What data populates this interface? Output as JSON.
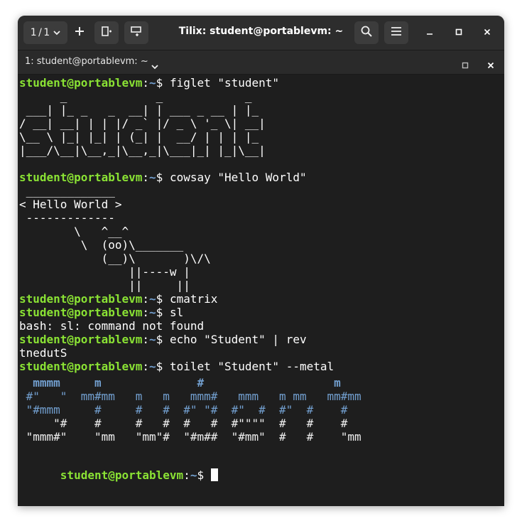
{
  "window": {
    "title": "Tilix: student@portablevm: ~",
    "session_counter": "1 / 1",
    "buttons": {
      "add": "+",
      "search": "⌕",
      "menu": "☰",
      "minimize": "–",
      "maximize": "□",
      "close": "✕"
    }
  },
  "tab": {
    "title": "1: student@portablevm: ~",
    "dropdown": "⌄",
    "maximize": "□",
    "close": "✕"
  },
  "terminal": {
    "prompt_user": "student@portablevm",
    "prompt_sep": ":",
    "prompt_path": "~",
    "prompt_symbol": "$ ",
    "lines": [
      {
        "type": "prompt",
        "cmd": "figlet \"student\""
      },
      {
        "type": "out",
        "text": "      _             _            _   \n ___| |_ _   _  __| | ___ _ __ | |_ \n/ __| __| | | |/ _` |/ _ \\ '_ \\| __|\n\\__ \\ |_| |_| | (_| |  __/ | | | |_ \n|___/\\__|\\__,_|\\__,_|\\___|_| |_|\\__|\n "
      },
      {
        "type": "prompt",
        "cmd": "cowsay \"Hello World\""
      },
      {
        "type": "out",
        "text": " _____________\n< Hello World >\n -------------\n        \\   ^__^\n         \\  (oo)\\_______\n            (__)\\       )\\/\\\n                ||----w |\n                ||     ||"
      },
      {
        "type": "prompt",
        "cmd": "cmatrix"
      },
      {
        "type": "prompt",
        "cmd": "sl"
      },
      {
        "type": "out",
        "text": "bash: sl: command not found"
      },
      {
        "type": "prompt",
        "cmd": "echo \"Student\" | rev"
      },
      {
        "type": "out",
        "text": "tnedutS"
      },
      {
        "type": "prompt",
        "cmd": "toilet \"Student\" --metal"
      }
    ],
    "toilet_art": [
      "  mmmm     m              #                   m   ",
      " #\"   \"  mm#mm   m   m   mmm#   mmm   m mm   mm#mm ",
      " \"#mmm     #     #   #  #\" \"#  #\"  #  #\"  #    #   ",
      "     \"#    #     #   #  #   #  #\"\"\"\"  #   #    #   ",
      " \"mmm#\"    \"mm   \"mm\"#  \"#m##  \"#mm\"  #   #    \"mm "
    ],
    "last_prompt": {
      "cmd": ""
    }
  },
  "colors": {
    "prompt_green": "#8ae234",
    "path_blue": "#729fcf",
    "terminal_bg": "#1e1e1e",
    "headerbar_bg": "#2d2d2d"
  }
}
